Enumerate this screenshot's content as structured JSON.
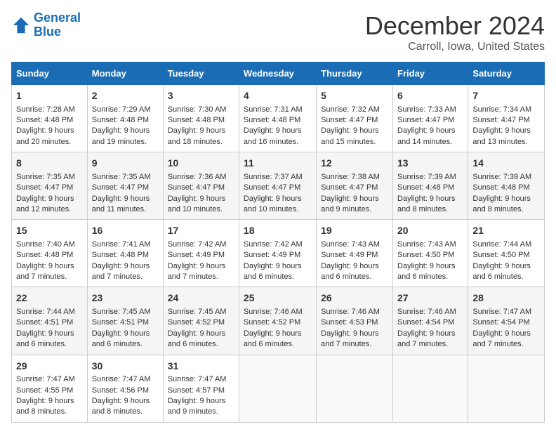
{
  "header": {
    "logo_line1": "General",
    "logo_line2": "Blue",
    "month": "December 2024",
    "location": "Carroll, Iowa, United States"
  },
  "days_of_week": [
    "Sunday",
    "Monday",
    "Tuesday",
    "Wednesday",
    "Thursday",
    "Friday",
    "Saturday"
  ],
  "weeks": [
    [
      {
        "day": "1",
        "sunrise": "7:28 AM",
        "sunset": "4:48 PM",
        "daylight": "9 hours and 20 minutes."
      },
      {
        "day": "2",
        "sunrise": "7:29 AM",
        "sunset": "4:48 PM",
        "daylight": "9 hours and 19 minutes."
      },
      {
        "day": "3",
        "sunrise": "7:30 AM",
        "sunset": "4:48 PM",
        "daylight": "9 hours and 18 minutes."
      },
      {
        "day": "4",
        "sunrise": "7:31 AM",
        "sunset": "4:48 PM",
        "daylight": "9 hours and 16 minutes."
      },
      {
        "day": "5",
        "sunrise": "7:32 AM",
        "sunset": "4:47 PM",
        "daylight": "9 hours and 15 minutes."
      },
      {
        "day": "6",
        "sunrise": "7:33 AM",
        "sunset": "4:47 PM",
        "daylight": "9 hours and 14 minutes."
      },
      {
        "day": "7",
        "sunrise": "7:34 AM",
        "sunset": "4:47 PM",
        "daylight": "9 hours and 13 minutes."
      }
    ],
    [
      {
        "day": "8",
        "sunrise": "7:35 AM",
        "sunset": "4:47 PM",
        "daylight": "9 hours and 12 minutes."
      },
      {
        "day": "9",
        "sunrise": "7:35 AM",
        "sunset": "4:47 PM",
        "daylight": "9 hours and 11 minutes."
      },
      {
        "day": "10",
        "sunrise": "7:36 AM",
        "sunset": "4:47 PM",
        "daylight": "9 hours and 10 minutes."
      },
      {
        "day": "11",
        "sunrise": "7:37 AM",
        "sunset": "4:47 PM",
        "daylight": "9 hours and 10 minutes."
      },
      {
        "day": "12",
        "sunrise": "7:38 AM",
        "sunset": "4:47 PM",
        "daylight": "9 hours and 9 minutes."
      },
      {
        "day": "13",
        "sunrise": "7:39 AM",
        "sunset": "4:48 PM",
        "daylight": "9 hours and 8 minutes."
      },
      {
        "day": "14",
        "sunrise": "7:39 AM",
        "sunset": "4:48 PM",
        "daylight": "9 hours and 8 minutes."
      }
    ],
    [
      {
        "day": "15",
        "sunrise": "7:40 AM",
        "sunset": "4:48 PM",
        "daylight": "9 hours and 7 minutes."
      },
      {
        "day": "16",
        "sunrise": "7:41 AM",
        "sunset": "4:48 PM",
        "daylight": "9 hours and 7 minutes."
      },
      {
        "day": "17",
        "sunrise": "7:42 AM",
        "sunset": "4:49 PM",
        "daylight": "9 hours and 7 minutes."
      },
      {
        "day": "18",
        "sunrise": "7:42 AM",
        "sunset": "4:49 PM",
        "daylight": "9 hours and 6 minutes."
      },
      {
        "day": "19",
        "sunrise": "7:43 AM",
        "sunset": "4:49 PM",
        "daylight": "9 hours and 6 minutes."
      },
      {
        "day": "20",
        "sunrise": "7:43 AM",
        "sunset": "4:50 PM",
        "daylight": "9 hours and 6 minutes."
      },
      {
        "day": "21",
        "sunrise": "7:44 AM",
        "sunset": "4:50 PM",
        "daylight": "9 hours and 6 minutes."
      }
    ],
    [
      {
        "day": "22",
        "sunrise": "7:44 AM",
        "sunset": "4:51 PM",
        "daylight": "9 hours and 6 minutes."
      },
      {
        "day": "23",
        "sunrise": "7:45 AM",
        "sunset": "4:51 PM",
        "daylight": "9 hours and 6 minutes."
      },
      {
        "day": "24",
        "sunrise": "7:45 AM",
        "sunset": "4:52 PM",
        "daylight": "9 hours and 6 minutes."
      },
      {
        "day": "25",
        "sunrise": "7:46 AM",
        "sunset": "4:52 PM",
        "daylight": "9 hours and 6 minutes."
      },
      {
        "day": "26",
        "sunrise": "7:46 AM",
        "sunset": "4:53 PM",
        "daylight": "9 hours and 7 minutes."
      },
      {
        "day": "27",
        "sunrise": "7:46 AM",
        "sunset": "4:54 PM",
        "daylight": "9 hours and 7 minutes."
      },
      {
        "day": "28",
        "sunrise": "7:47 AM",
        "sunset": "4:54 PM",
        "daylight": "9 hours and 7 minutes."
      }
    ],
    [
      {
        "day": "29",
        "sunrise": "7:47 AM",
        "sunset": "4:55 PM",
        "daylight": "9 hours and 8 minutes."
      },
      {
        "day": "30",
        "sunrise": "7:47 AM",
        "sunset": "4:56 PM",
        "daylight": "9 hours and 8 minutes."
      },
      {
        "day": "31",
        "sunrise": "7:47 AM",
        "sunset": "4:57 PM",
        "daylight": "9 hours and 9 minutes."
      },
      null,
      null,
      null,
      null
    ]
  ]
}
